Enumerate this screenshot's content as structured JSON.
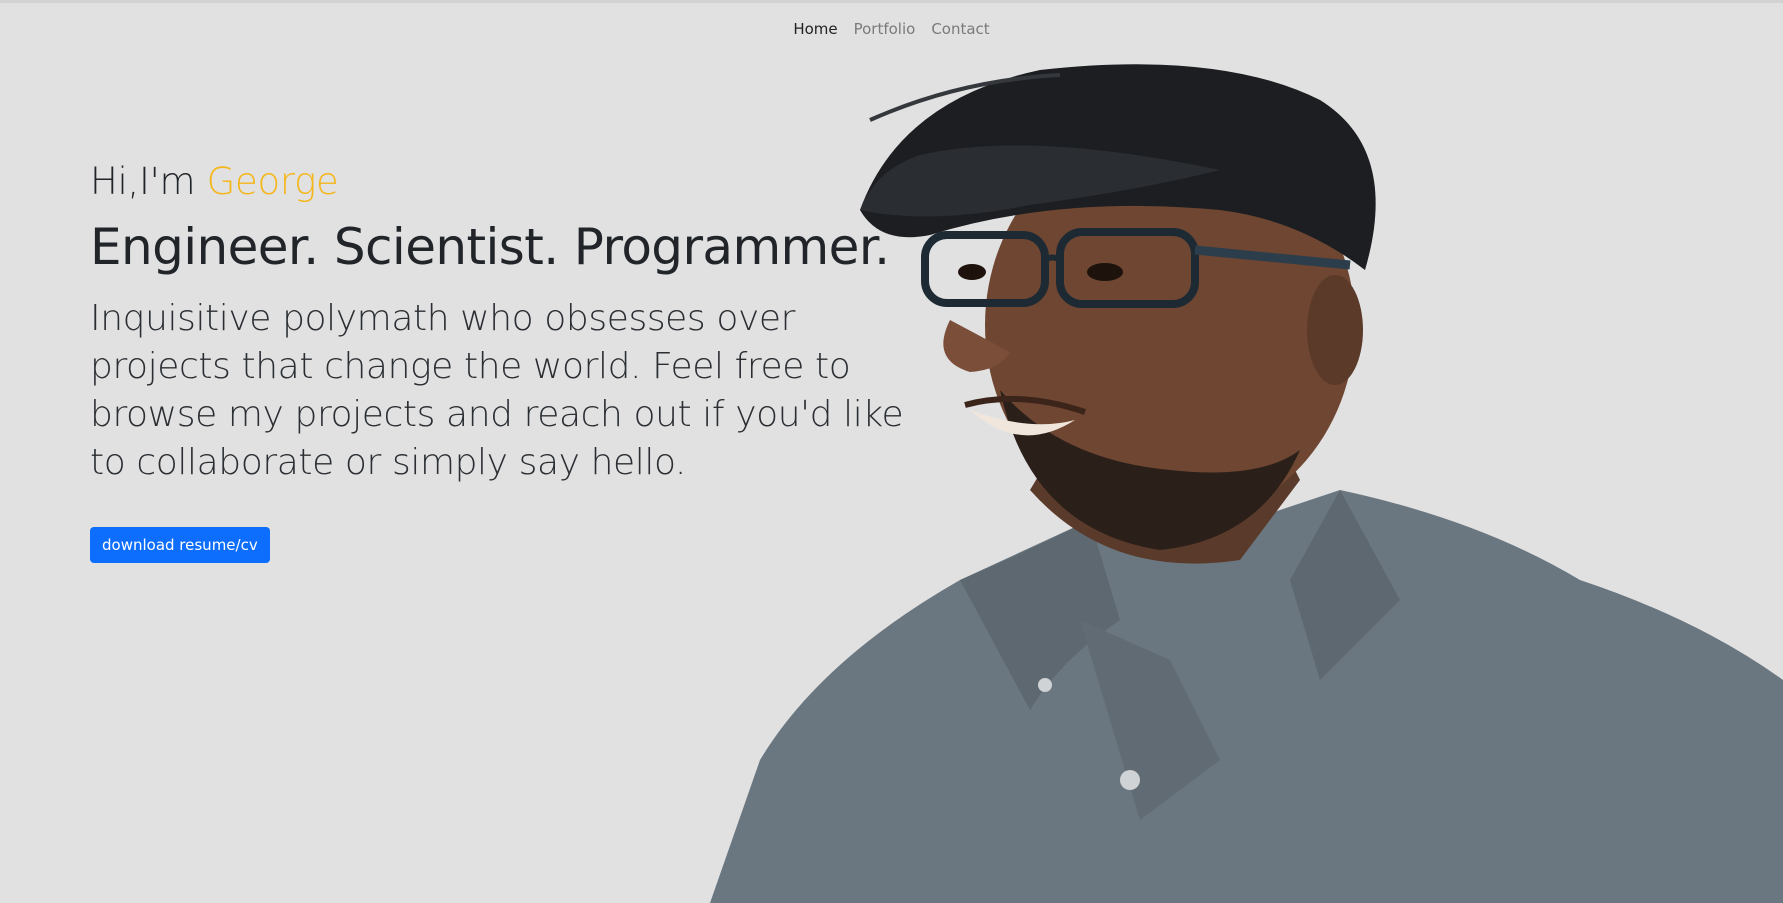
{
  "nav": {
    "items": [
      {
        "label": "Home",
        "active": true
      },
      {
        "label": "Portfolio",
        "active": false
      },
      {
        "label": "Contact",
        "active": false
      }
    ]
  },
  "hero": {
    "greeting_prefix": "Hi,I'm",
    "name": "George",
    "headline": "Engineer. Scientist. Programmer.",
    "bio": "Inquisitive polymath who obsesses over projects that change the world. Feel free to browse my projects and reach out if you'd like to collaborate or simply say hello.",
    "button_label": "download resume/cv"
  },
  "colors": {
    "background": "#e1e1e1",
    "accent_name": "#f4b61a",
    "button": "#0d6efd"
  }
}
